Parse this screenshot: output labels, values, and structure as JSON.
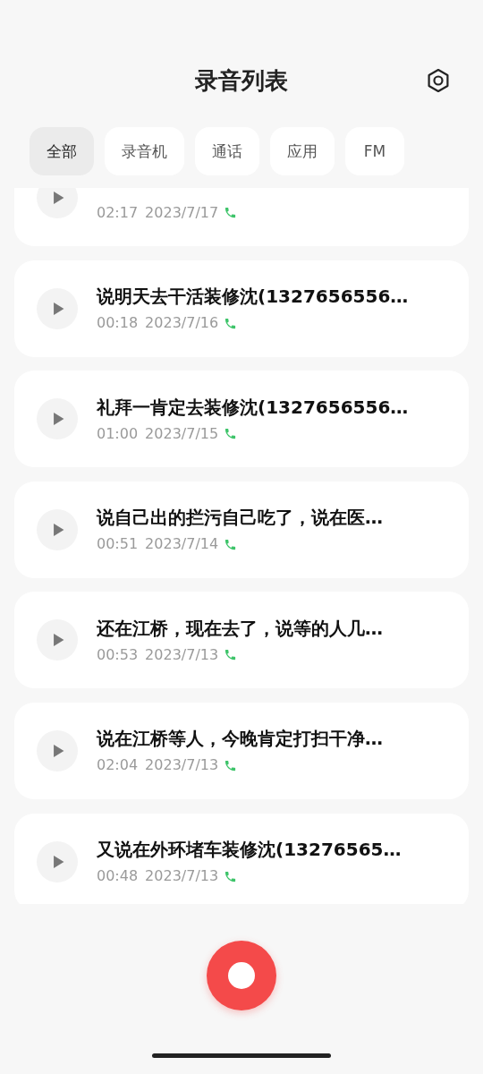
{
  "header": {
    "title": "录音列表"
  },
  "tabs": [
    {
      "label": "全部",
      "selected": true
    },
    {
      "label": "录音机",
      "selected": false
    },
    {
      "label": "通话",
      "selected": false
    },
    {
      "label": "应用",
      "selected": false
    },
    {
      "label": "FM",
      "selected": false
    }
  ],
  "recordings": [
    {
      "duration": "02:17",
      "date": "2023/7/17",
      "call": true
    },
    {
      "title": "说明天去干活装修沈(1327656556…",
      "duration": "00:18",
      "date": "2023/7/16",
      "call": true
    },
    {
      "title": "礼拜一肯定去装修沈(1327656556…",
      "duration": "01:00",
      "date": "2023/7/15",
      "call": true
    },
    {
      "title": "说自己出的拦污自己吃了，说在医…",
      "duration": "00:51",
      "date": "2023/7/14",
      "call": true
    },
    {
      "title": "还在江桥，现在去了，说等的人几…",
      "duration": "00:53",
      "date": "2023/7/13",
      "call": true
    },
    {
      "title": "说在江桥等人，今晚肯定打扫干净…",
      "duration": "02:04",
      "date": "2023/7/13",
      "call": true
    },
    {
      "title": "又说在外环堵车装修沈(13276565…",
      "duration": "00:48",
      "date": "2023/7/13",
      "call": true
    }
  ]
}
